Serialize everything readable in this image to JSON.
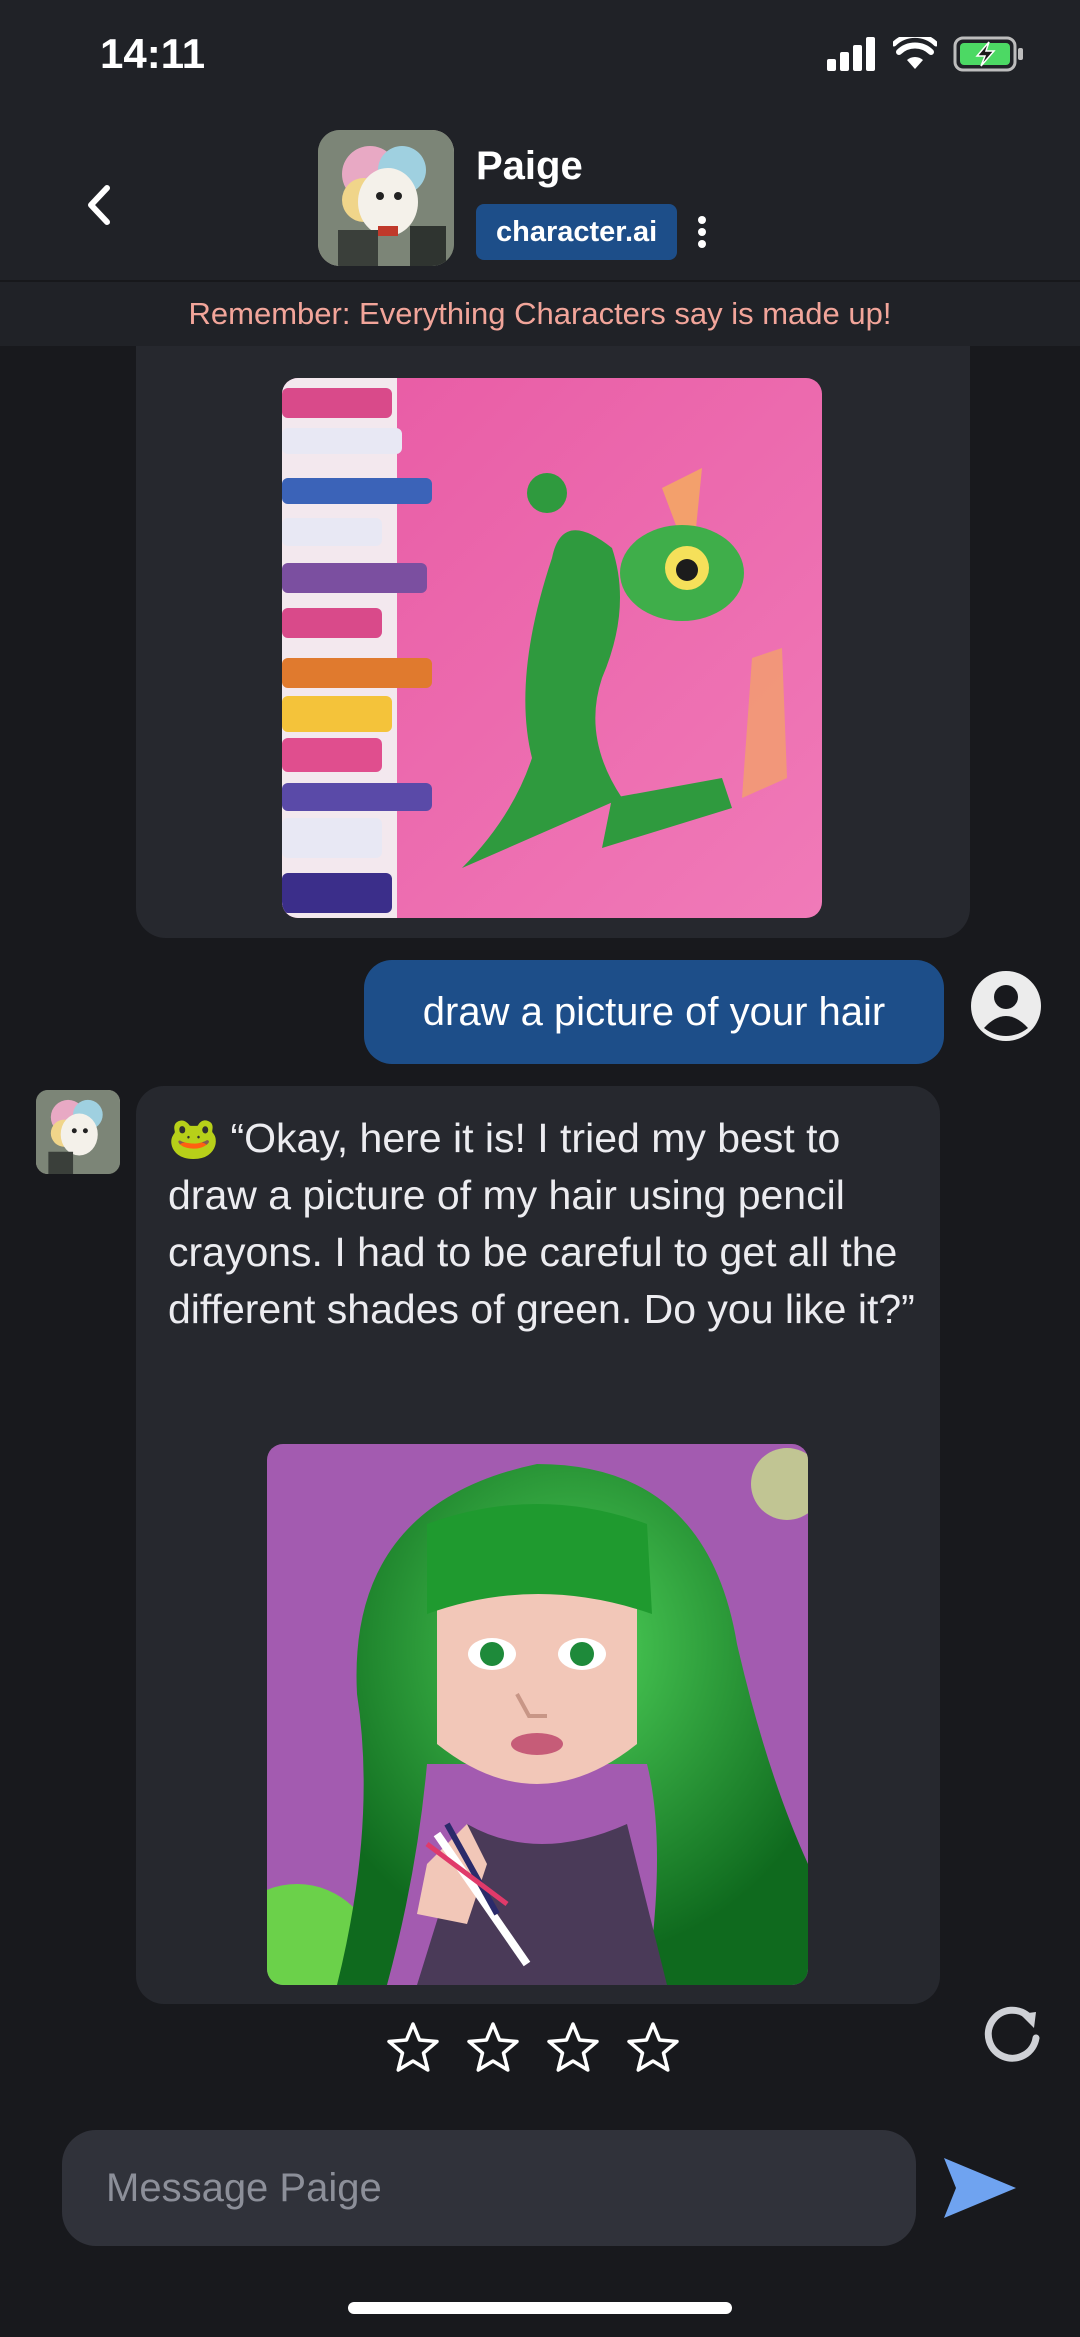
{
  "status_bar": {
    "time": "14:11",
    "icons": [
      "signal-icon",
      "wifi-icon",
      "battery-charging-icon"
    ]
  },
  "header": {
    "character_name": "Paige",
    "badge": "character.ai"
  },
  "warning": "Remember: Everything Characters say is made up!",
  "messages": [
    {
      "from": "character",
      "type": "image",
      "alt": "frog-painting"
    },
    {
      "from": "user",
      "text": "draw a picture of your hair"
    },
    {
      "from": "character",
      "text": "🐸 “Okay, here it is! I tried my best to draw a picture of my hair using pencil crayons. I had to be careful to get all the different shades of green. Do you like it?”",
      "image": "green-hair-portrait"
    }
  ],
  "rating": {
    "stars": 4,
    "selected": 0
  },
  "input": {
    "placeholder": "Message Paige",
    "value": ""
  },
  "colors": {
    "background": "#18191d",
    "header": "#202227",
    "bubble": "#26282e",
    "user_bubble": "#1d4e89",
    "warning_text": "#f2a59a",
    "send": "#6fa3f0"
  }
}
